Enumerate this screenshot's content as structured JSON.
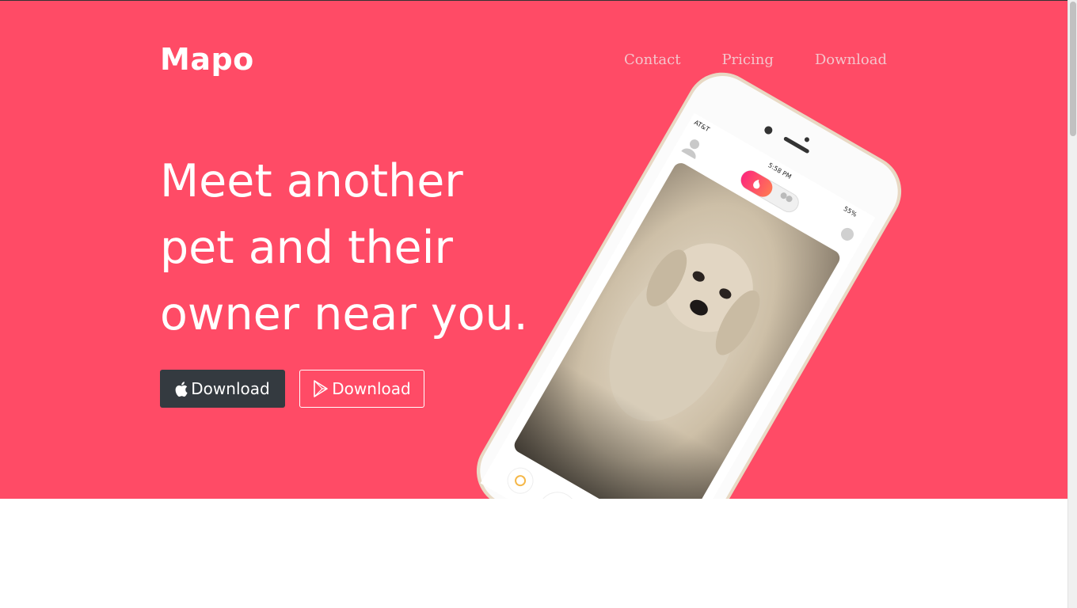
{
  "brand": "Mapo",
  "nav": {
    "items": [
      "Contact",
      "Pricing",
      "Download"
    ]
  },
  "hero": {
    "headline_lines": [
      "Meet another",
      "pet and their",
      "owner near you."
    ],
    "ios_button_label": "Download",
    "play_button_label": "Download"
  },
  "phone": {
    "carrier": "AT&T",
    "time": "5:58 PM",
    "battery": "55%"
  },
  "colors": {
    "hero_bg": "#ff4b66",
    "nav_text": "#f4c5cc",
    "dark_button": "#343a40",
    "white": "#ffffff"
  },
  "icons": {
    "ios_button_icon": "apple-icon",
    "play_button_icon": "google-play-icon",
    "profile_icon": "user-icon",
    "chat_icon": "chat-bubble-icon",
    "flame_icon": "flame-icon",
    "group_icon": "group-icon",
    "rewind_icon": "rewind-icon"
  }
}
